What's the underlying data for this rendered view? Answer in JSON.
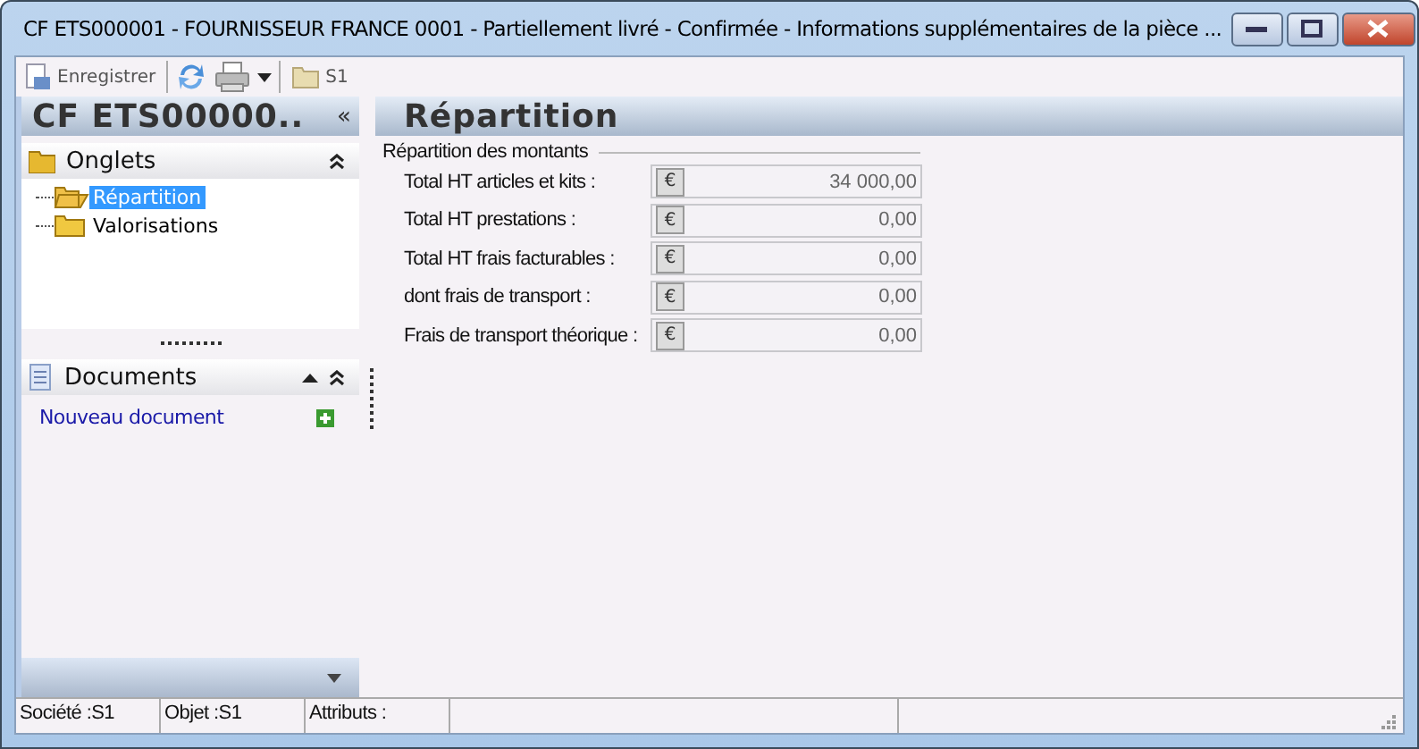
{
  "window": {
    "title": "CF ETS000001 - FOURNISSEUR FRANCE 0001 - Partiellement livré - Confirmée -  Informations supplémentaires de la pièce ..."
  },
  "toolbar": {
    "save_label": "Enregistrer",
    "folder_label": "S1"
  },
  "sidebar": {
    "header": "CF ETS00000..",
    "collapse_glyph": "«",
    "tabs_section": {
      "title": "Onglets",
      "expanded": true,
      "items": [
        {
          "label": "Répartition",
          "selected": true
        },
        {
          "label": "Valorisations",
          "selected": false
        }
      ]
    },
    "documents_section": {
      "title": "Documents",
      "link": "Nouveau document"
    }
  },
  "main": {
    "title": "Répartition",
    "group": "Répartition des montants",
    "fields": [
      {
        "label": "Total HT articles et kits :",
        "currency": "€",
        "value": "34 000,00"
      },
      {
        "label": "Total HT prestations :",
        "currency": "€",
        "value": "0,00"
      },
      {
        "label": "Total HT frais facturables :",
        "currency": "€",
        "value": "0,00"
      },
      {
        "label": "dont frais de transport :",
        "currency": "€",
        "value": "0,00"
      },
      {
        "label": "Frais de transport théorique :",
        "currency": "€",
        "value": "0,00"
      }
    ]
  },
  "status_bar": [
    "Société :S1",
    "Objet :S1",
    "Attributs :"
  ]
}
